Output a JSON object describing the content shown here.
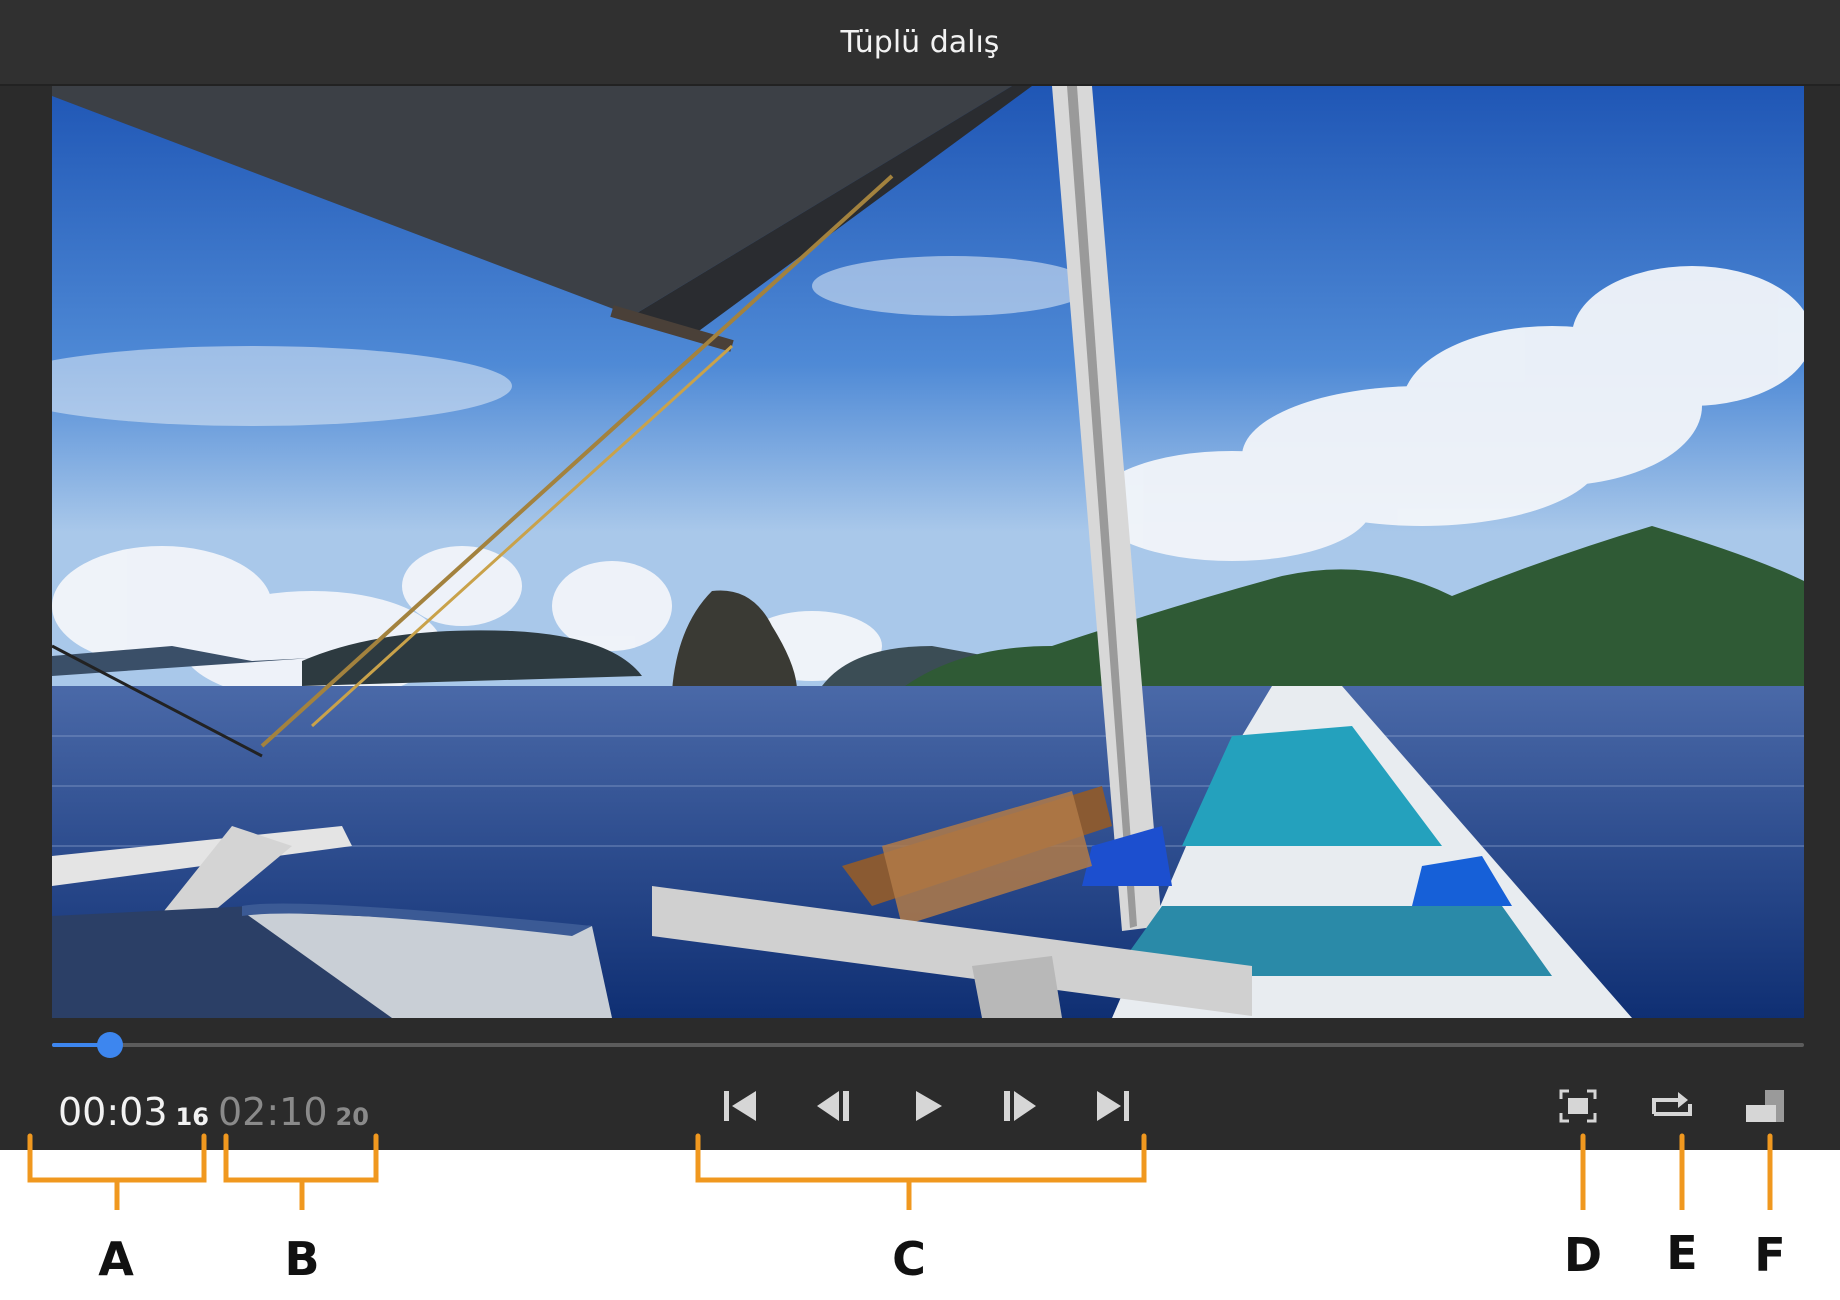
{
  "window": {
    "title": "Tüplü dalış"
  },
  "playback": {
    "current_time": "00:03",
    "current_frames": "16",
    "total_time": "02:10",
    "total_frames": "20",
    "progress": 0.033
  },
  "controls": {
    "transport": [
      "skip-to-start-icon",
      "step-back-icon",
      "play-icon",
      "step-forward-icon",
      "skip-to-end-icon"
    ],
    "right": [
      "fit-screen-icon",
      "loop-icon",
      "window-mode-icon"
    ]
  },
  "annotations": {
    "labels": [
      "A",
      "B",
      "C",
      "D",
      "E",
      "F"
    ],
    "color": "#f0981f"
  },
  "colors": {
    "accent": "#3d86ef",
    "player_bg": "#2b2b2b"
  }
}
